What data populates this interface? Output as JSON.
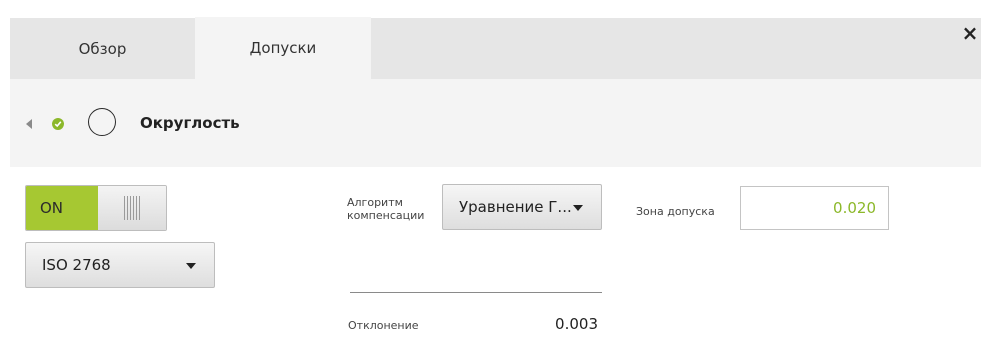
{
  "tabs": [
    {
      "label": "Обзор",
      "active": false
    },
    {
      "label": "Допуски",
      "active": true
    }
  ],
  "close_label": "×",
  "feature": {
    "title": "Округлость",
    "status": "ok",
    "icon": "circle-icon"
  },
  "toggle": {
    "on_label": "ON",
    "state": "on"
  },
  "standard": {
    "selected": "ISO 2768"
  },
  "algorithm": {
    "label": "Алгоритм компенсации",
    "selected": "Уравнение Г..."
  },
  "tolerance_zone": {
    "label": "Зона допуска",
    "value": "0.020"
  },
  "deviation": {
    "label": "Отклонение",
    "value": "0.003"
  },
  "colors": {
    "accent": "#a6c832",
    "ok": "#8cb82a",
    "value_green": "#8cb82a"
  }
}
